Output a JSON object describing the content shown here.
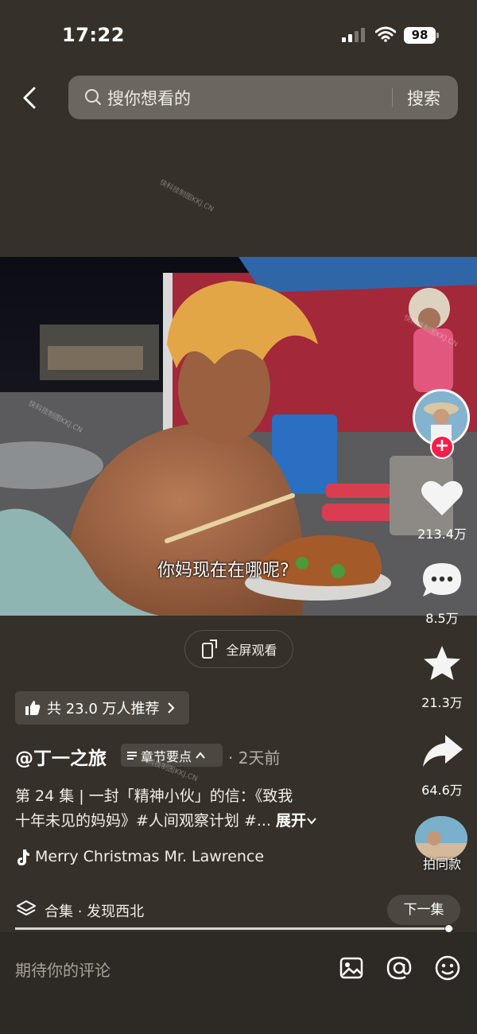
{
  "status_bar": {
    "time": "17:22",
    "battery": "98"
  },
  "search": {
    "placeholder": "搜你想看的",
    "button_label": "搜索"
  },
  "watermark": "快科技制图KKJ.CN",
  "video": {
    "subtitle": "你妈现在在哪呢?"
  },
  "fullscreen_label": "全屏观看",
  "actions": {
    "likes": "213.4万",
    "comments": "8.5万",
    "favorites": "21.3万",
    "shares": "64.6万",
    "same_style": "拍同款"
  },
  "recommend": {
    "label": "共 23.0 万人推荐"
  },
  "post": {
    "author": "@丁一之旅",
    "chapter_label": "章节要点",
    "time": "· 2天前",
    "description_line1": "第 24 集 | 一封「精神小伙」的信：《致我",
    "description_line2": "十年未见的妈妈》#人间观察计划 #...",
    "expand_label": "展开",
    "music": "Merry Christmas Mr. Lawrence"
  },
  "collection": {
    "label": "合集 · 发现西北",
    "next_label": "下一集",
    "progress": 0.98
  },
  "comment": {
    "placeholder": "期待你的评论"
  },
  "colors": {
    "background": "#353029",
    "follow_red": "#f0204a"
  }
}
